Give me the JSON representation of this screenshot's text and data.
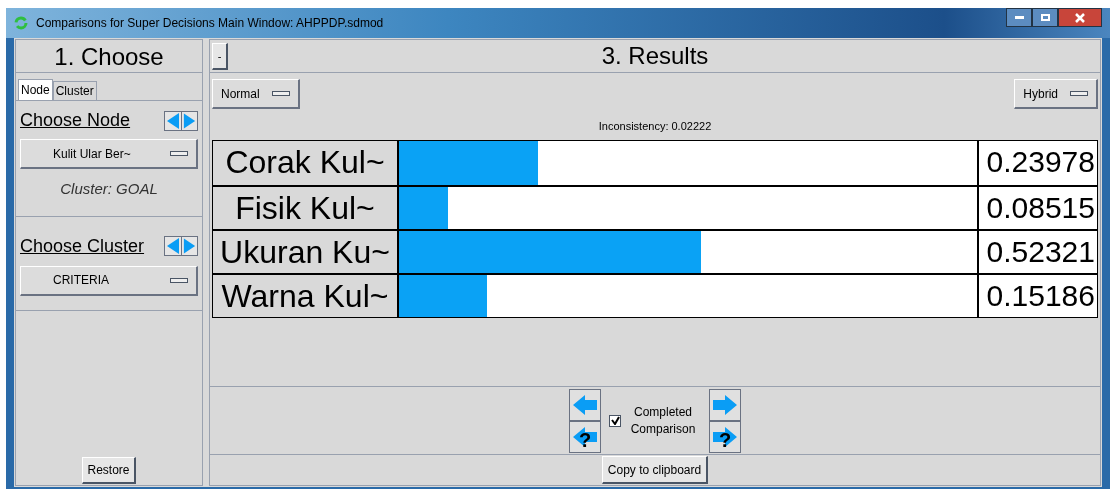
{
  "window": {
    "title": "Comparisons for Super Decisions Main Window: AHPPDP.sdmod"
  },
  "choose": {
    "heading": "1. Choose",
    "tabs": [
      {
        "label": "Node",
        "selected": true
      },
      {
        "label": "Cluster",
        "selected": false
      }
    ],
    "node_heading": "Choose Node",
    "node_value": "Kulit Ular Ber~",
    "cluster_caption": "Cluster: GOAL",
    "cluster_heading": "Choose Cluster",
    "cluster_value": "CRITERIA",
    "restore": "Restore"
  },
  "results": {
    "heading": "3. Results",
    "collapse": "-",
    "mode": "Normal",
    "view": "Hybrid",
    "inconsistency": "Inconsistency: 0.02222",
    "rows": [
      {
        "label": "Corak Kul~",
        "level": 0.23978,
        "value": "0.23978"
      },
      {
        "label": "Fisik Kul~",
        "level": 0.08515,
        "value": "0.08515"
      },
      {
        "label": "Ukuran Ku~",
        "level": 0.52321,
        "value": "0.52321"
      },
      {
        "label": "Warna Kul~",
        "level": 0.15186,
        "value": "0.15186"
      }
    ],
    "completed": {
      "label": "Completed Comparison",
      "checked": true
    },
    "unfinished_marks": [
      "?",
      "?"
    ],
    "copy": "Copy to clipboard"
  }
}
